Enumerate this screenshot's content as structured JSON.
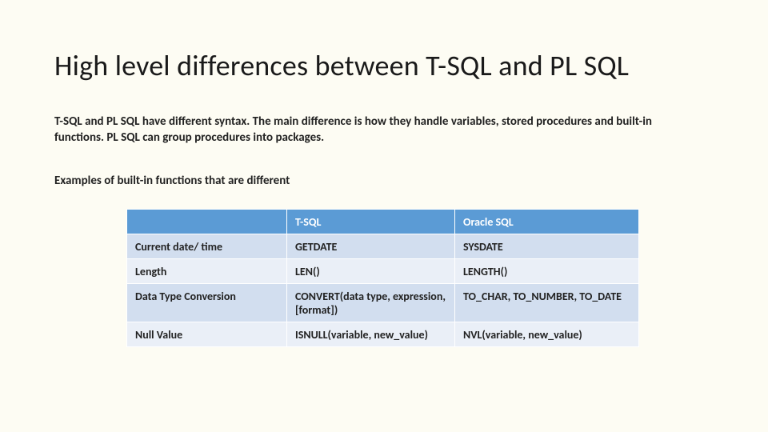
{
  "title": "High level differences between T-SQL and PL SQL",
  "intro": "T-SQL and PL SQL have different syntax. The main difference is how they handle variables, stored procedures and built-in functions. PL SQL can group procedures into packages.",
  "subhead": "Examples of built-in functions that are different",
  "table": {
    "headers": {
      "tsql": "T-SQL",
      "oracle": "Oracle SQL"
    },
    "rows": {
      "r0": {
        "label": "Current date/ time",
        "tsql": "GETDATE",
        "oracle": "SYSDATE"
      },
      "r1": {
        "label": "Length",
        "tsql": "LEN()",
        "oracle": "LENGTH()"
      },
      "r2": {
        "label": "Data Type Conversion",
        "tsql": "CONVERT(data type, expression, [format])",
        "oracle": "TO_CHAR, TO_NUMBER, TO_DATE"
      },
      "r3": {
        "label": "Null Value",
        "tsql": "ISNULL(variable, new_value)",
        "oracle": "NVL(variable, new_value)"
      }
    }
  }
}
